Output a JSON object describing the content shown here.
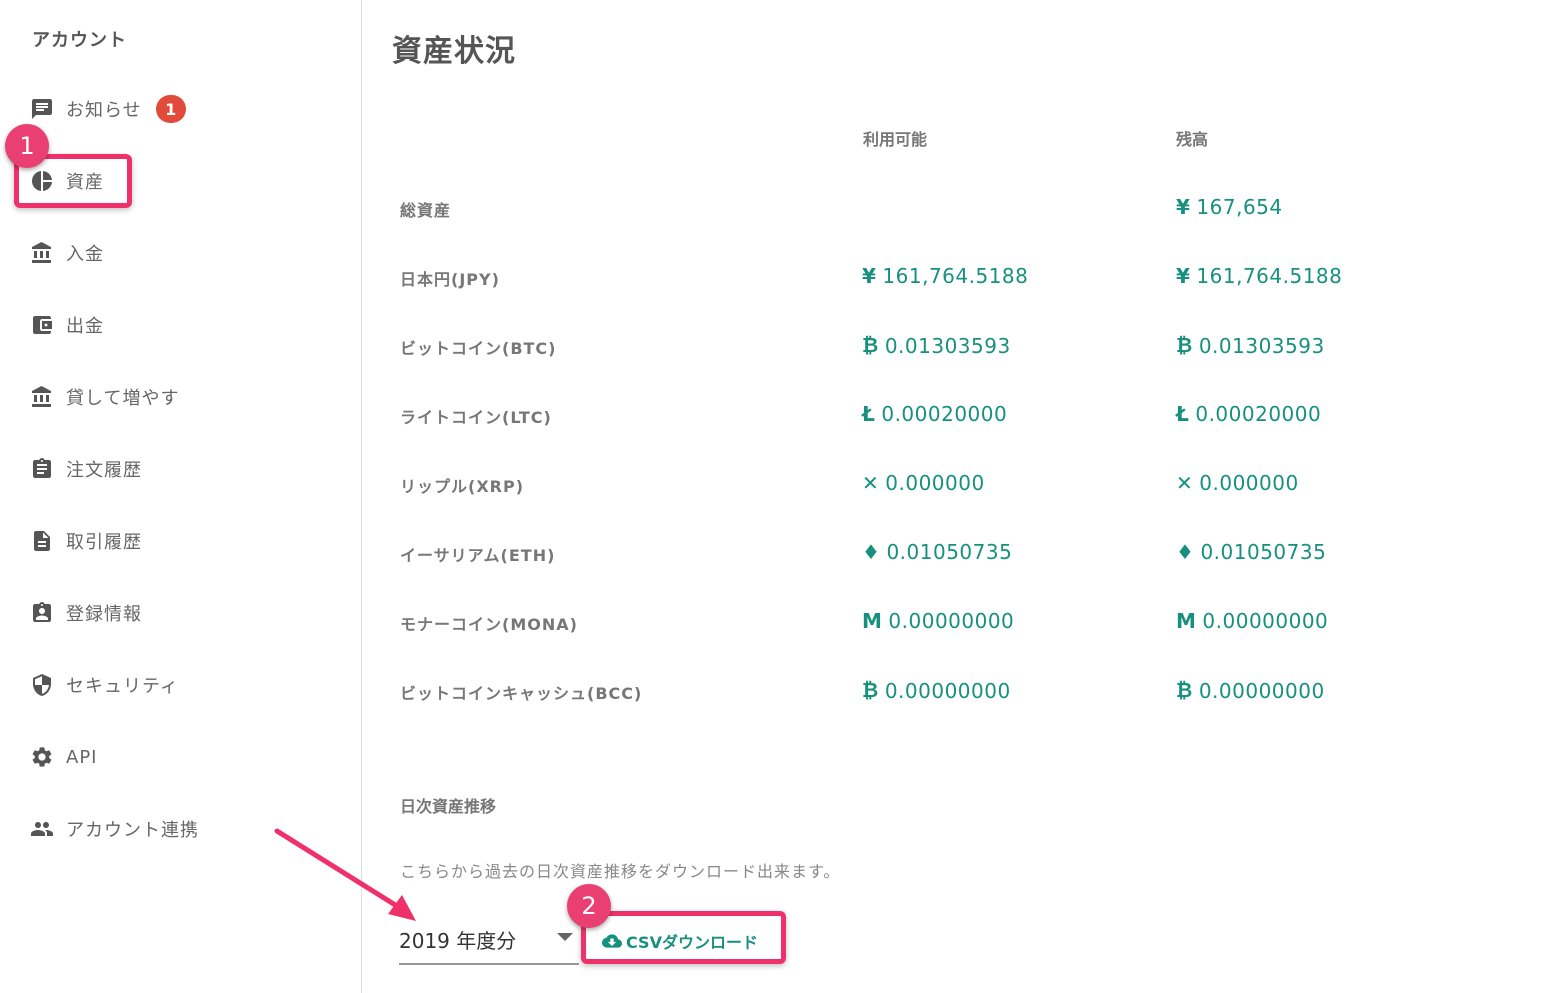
{
  "sidebar": {
    "title": "アカウント",
    "items": [
      {
        "label": "お知らせ",
        "icon": "message-icon",
        "badge": "1"
      },
      {
        "label": "資産",
        "icon": "pie-chart-icon"
      },
      {
        "label": "入金",
        "icon": "bank-icon"
      },
      {
        "label": "出金",
        "icon": "wallet-icon"
      },
      {
        "label": "貸して増やす",
        "icon": "bank-icon"
      },
      {
        "label": "注文履歴",
        "icon": "clipboard-icon"
      },
      {
        "label": "取引履歴",
        "icon": "document-icon"
      },
      {
        "label": "登録情報",
        "icon": "id-badge-icon"
      },
      {
        "label": "セキュリティ",
        "icon": "shield-icon"
      },
      {
        "label": "API",
        "icon": "gear-icon"
      },
      {
        "label": "アカウント連携",
        "icon": "people-icon"
      }
    ]
  },
  "annotations": {
    "step1": "1",
    "step2": "2",
    "highlight_color": "#f0306b",
    "arrow_color": "#f0306b"
  },
  "main": {
    "title": "資産状況",
    "columns": {
      "available": "利用可能",
      "balance": "残高"
    },
    "rows": [
      {
        "label": "総資産",
        "symbol": "¥",
        "available": "",
        "balance": "167,654"
      },
      {
        "label": "日本円(JPY)",
        "symbol": "¥",
        "available": "161,764.5188",
        "balance": "161,764.5188"
      },
      {
        "label": "ビットコイン(BTC)",
        "symbol": "₿",
        "available": "0.01303593",
        "balance": "0.01303593"
      },
      {
        "label": "ライトコイン(LTC)",
        "symbol": "Ł",
        "available": "0.00020000",
        "balance": "0.00020000"
      },
      {
        "label": "リップル(XRP)",
        "symbol": "✕",
        "available": "0.000000",
        "balance": "0.000000"
      },
      {
        "label": "イーサリアム(ETH)",
        "symbol": "♦",
        "available": "0.01050735",
        "balance": "0.01050735"
      },
      {
        "label": "モナーコイン(MONA)",
        "symbol": "M",
        "available": "0.00000000",
        "balance": "0.00000000"
      },
      {
        "label": "ビットコインキャッシュ(BCC)",
        "symbol": "₿",
        "available": "0.00000000",
        "balance": "0.00000000"
      }
    ],
    "daily": {
      "heading": "日次資産推移",
      "description": "こちらから過去の日次資産推移をダウンロード出来ます。",
      "year_value": "2019 年度分",
      "csv_label": "CSVダウンロード"
    },
    "accent_color": "#17917e"
  }
}
